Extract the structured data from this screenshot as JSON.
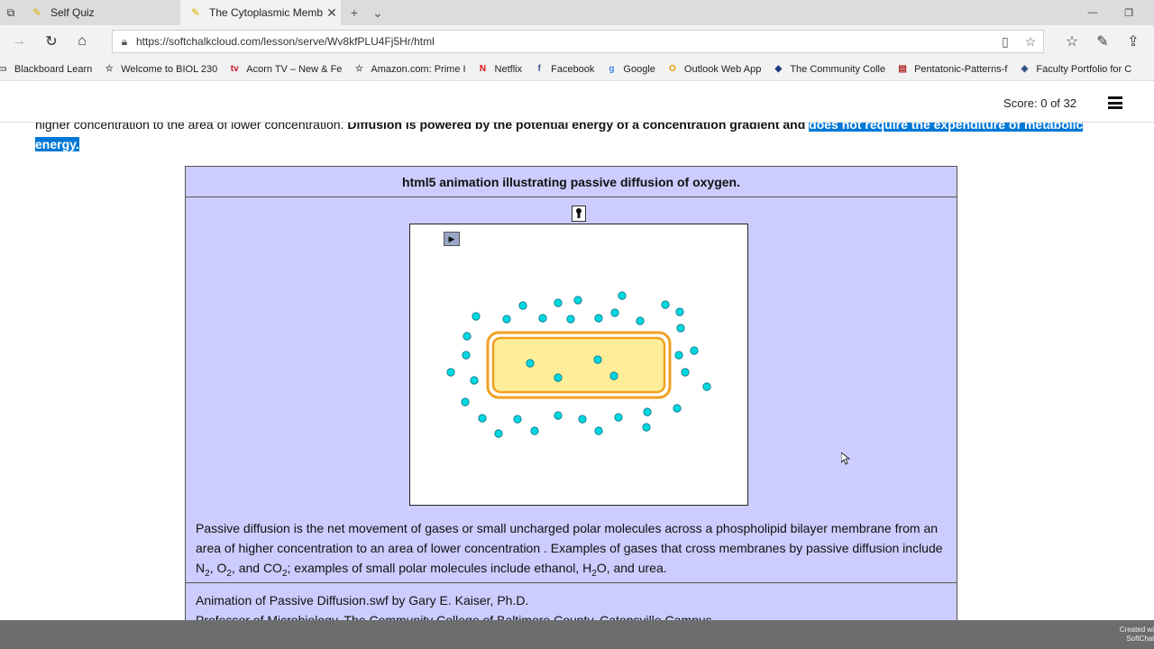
{
  "browser": {
    "tabs": [
      {
        "label": "Self Quiz",
        "active": false
      },
      {
        "label": "The Cytoplasmic Memb",
        "active": true
      }
    ],
    "url": "https://softchalkcloud.com/lesson/serve/Wv8kfPLU4Fj5Hr/html",
    "favorites": [
      {
        "label": "Blackboard Learn",
        "icon": "page-icon",
        "color": "#555555"
      },
      {
        "label": "Welcome to BIOL 230",
        "icon": "star-icon",
        "color": "#555555"
      },
      {
        "label": "Acorn TV – New & Fe",
        "icon": "acorn-tv-icon",
        "color": "#c8102e"
      },
      {
        "label": "Amazon.com: Prime I",
        "icon": "star-icon",
        "color": "#555555"
      },
      {
        "label": "Netflix",
        "icon": "netflix-icon",
        "color": "#e50914"
      },
      {
        "label": "Facebook",
        "icon": "facebook-icon",
        "color": "#3b5998"
      },
      {
        "label": "Google",
        "icon": "google-icon",
        "color": "#4285f4"
      },
      {
        "label": "Outlook Web App",
        "icon": "outlook-icon",
        "color": "#e8a000"
      },
      {
        "label": "The Community Colle",
        "icon": "ccbc-icon",
        "color": "#1a3a7a"
      },
      {
        "label": "Pentatonic-Patterns-f",
        "icon": "pdf-icon",
        "color": "#b22222"
      },
      {
        "label": "Faculty Portfolio for C",
        "icon": "portfolio-icon",
        "color": "#2a4a7a"
      }
    ]
  },
  "lesson": {
    "score": "Score: 0 of 32",
    "intro_plain": "higher concentration to the area of lower concentration. ",
    "intro_bold": "Diffusion is powered by the potential energy of a concentration gradient and ",
    "intro_highlight": "does not require the expenditure of metabolic energy.",
    "animation": {
      "caption": "html5 animation illustrating passive diffusion of oxygen.",
      "colors": {
        "molecule": "#00d8e0",
        "cell_fill": "#ffee99",
        "cell_border": "#f0a020",
        "panel": "#ccccff"
      },
      "molecules_outside": 44,
      "molecules_inside": 4
    },
    "description": {
      "line1": "Passive diffusion is the net movement of gases or small uncharged polar molecules across a phospholipid bilayer membrane from an area of higher concentration to an area of lower concentration . Examples of gases that cross membranes by passive diffusion include ",
      "n": "N",
      "sub2": "2",
      "comma": ", ",
      "o": "O",
      "and_co": ", and CO",
      "tail": "; examples of small polar molecules include ethanol, H",
      "tail2": "O, and urea."
    },
    "credit_line1": "Animation of Passive Diffusion.swf by Gary E. Kaiser, Ph.D.",
    "credit_line2": "Professor of Microbiology, The Community College of Baltimore County, Catonsville Campus"
  },
  "footer": {
    "made_with_1": "Created wi",
    "made_with_2": "SoftChal"
  }
}
